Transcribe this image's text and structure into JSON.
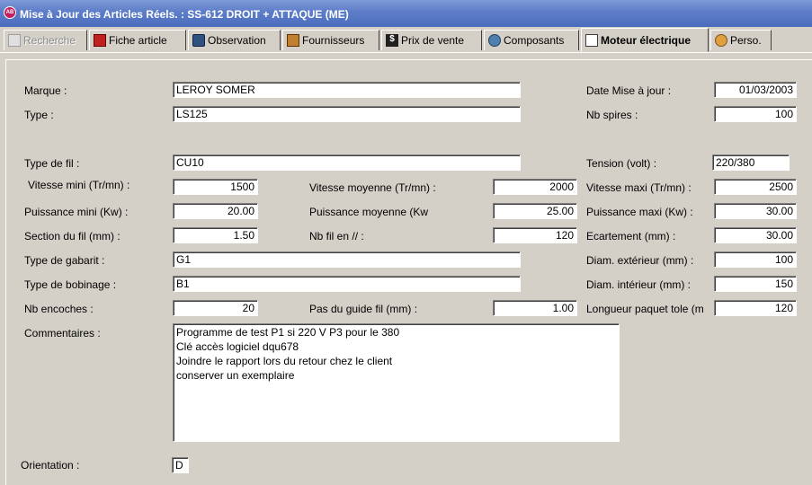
{
  "window": {
    "title": "Mise à Jour des Articles Réels. : SS-612 DROIT + ATTAQUE (ME)"
  },
  "tabs": [
    {
      "label": "Recherche"
    },
    {
      "label": "Fiche article"
    },
    {
      "label": "Observation"
    },
    {
      "label": "Fournisseurs"
    },
    {
      "label": "Prix de vente"
    },
    {
      "label": "Composants"
    },
    {
      "label": "Moteur électrique"
    },
    {
      "label": "Perso."
    }
  ],
  "form": {
    "marque": {
      "label": "Marque :",
      "value": "LEROY SOMER"
    },
    "type": {
      "label": "Type :",
      "value": "LS125"
    },
    "date_maj": {
      "label": "Date Mise à jour :",
      "value": "01/03/2003"
    },
    "nb_spires": {
      "label": "Nb spires :",
      "value": "100"
    },
    "type_fil": {
      "label": "Type de fil :",
      "value": "CU10"
    },
    "tension": {
      "label": "Tension (volt) :",
      "value": "220/380"
    },
    "vitesse_mini": {
      "label": "Vitesse mini (Tr/mn) :",
      "value": "1500"
    },
    "vitesse_moy": {
      "label": "Vitesse moyenne (Tr/mn) :",
      "value": "2000"
    },
    "vitesse_maxi": {
      "label": "Vitesse maxi (Tr/mn) :",
      "value": "2500"
    },
    "puissance_mini": {
      "label": "Puissance mini   (Kw) :",
      "value": "20.00"
    },
    "puissance_moy": {
      "label": "Puissance moyenne    (Kw",
      "value": "25.00"
    },
    "puissance_maxi": {
      "label": "Puissance maxi   (Kw) :",
      "value": "30.00"
    },
    "section_fil": {
      "label": "Section du fil (mm) :",
      "value": "1.50"
    },
    "nb_fil": {
      "label": "Nb fil en // :",
      "value": "120"
    },
    "ecartement": {
      "label": "Ecartement  (mm) :",
      "value": "30.00"
    },
    "type_gabarit": {
      "label": "Type de gabarit :",
      "value": "G1"
    },
    "diam_ext": {
      "label": "Diam. extérieur (mm) :",
      "value": "100"
    },
    "type_bobinage": {
      "label": "Type de bobinage :",
      "value": "B1"
    },
    "diam_int": {
      "label": "Diam. intérieur (mm) :",
      "value": "150"
    },
    "nb_encoches": {
      "label": "Nb encoches :",
      "value": "20"
    },
    "pas_guide": {
      "label": "Pas du guide fil (mm) :",
      "value": "1.00"
    },
    "longueur_paquet": {
      "label": "Longueur paquet tole (m",
      "value": "120"
    },
    "commentaires": {
      "label": "Commentaires :",
      "lines": [
        "Programme de test P1 si 220 V P3 pour le 380",
        "Clé accès logiciel dqu678",
        "Joindre le rapport lors du retour chez le client",
        "conserver un exemplaire"
      ]
    },
    "orientation": {
      "label": "Orientation :",
      "value": "D"
    }
  }
}
